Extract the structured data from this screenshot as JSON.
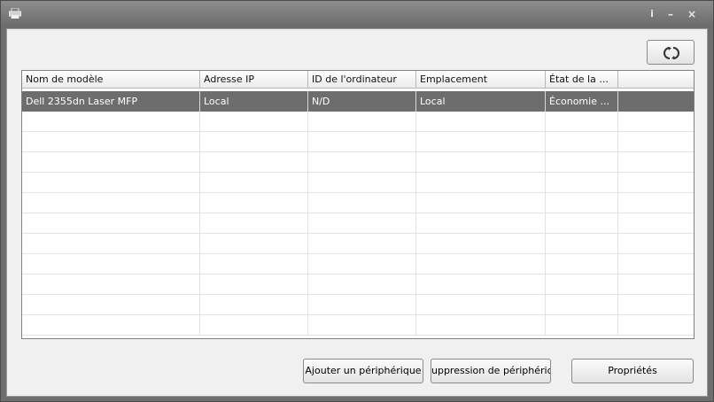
{
  "titlebar": {
    "icon": "printer-app-icon",
    "info_label": "i",
    "minimize_label": "–",
    "close_label": "×"
  },
  "toolbar": {
    "refresh_icon": "refresh-icon"
  },
  "table": {
    "columns": [
      "Nom de modèle",
      "Adresse IP",
      "ID de l'ordinateur",
      "Emplacement",
      "État de la ...",
      ""
    ],
    "rows": [
      [
        "Dell 2355dn Laser MFP",
        "Local",
        "N/D",
        "Local",
        "Économie ...",
        ""
      ]
    ],
    "selected_row": 0,
    "empty_row_count": 11
  },
  "buttons": {
    "add": "Ajouter un périphérique",
    "remove": "uppression de périphériqu",
    "properties": "Propriétés"
  },
  "colors": {
    "titlebar": "#7a7a7a",
    "selected_row": "#6d6d6d",
    "client": "#f0f0f0"
  }
}
